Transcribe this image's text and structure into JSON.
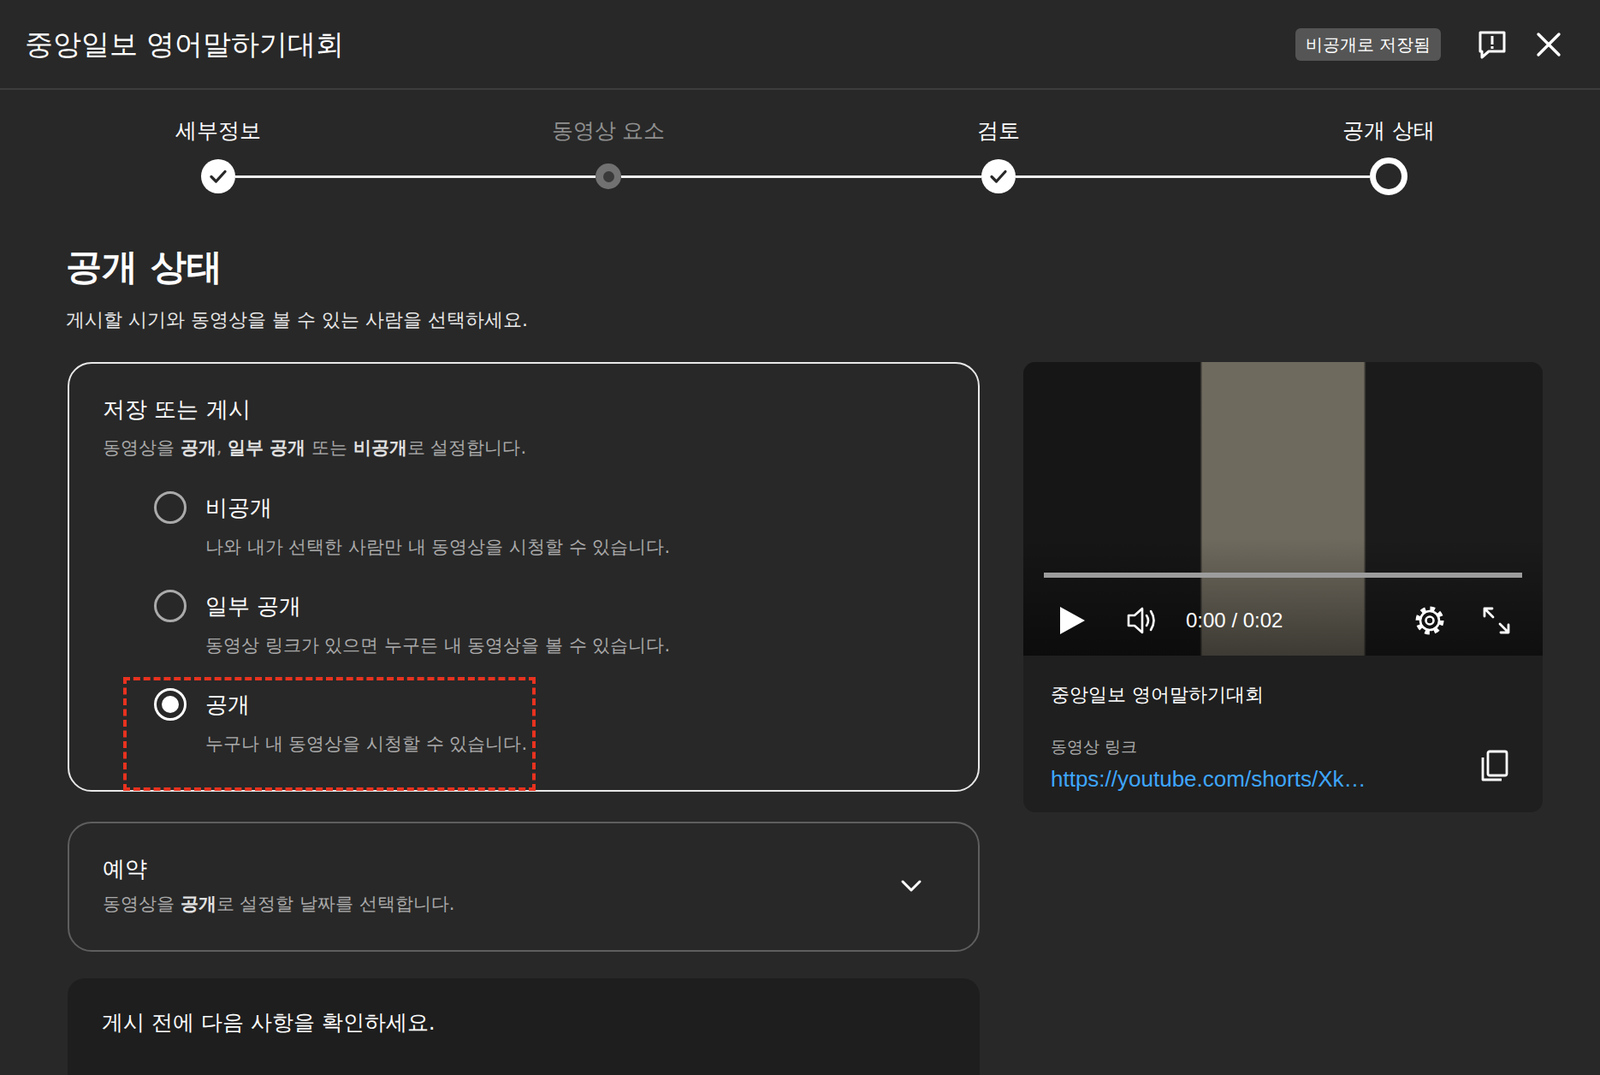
{
  "header": {
    "title": "중앙일보 영어말하기대회",
    "badge": "비공개로 저장됨"
  },
  "steps": [
    {
      "label": "세부정보",
      "state": "done"
    },
    {
      "label": "동영상 요소",
      "state": "pending"
    },
    {
      "label": "검토",
      "state": "done"
    },
    {
      "label": "공개 상태",
      "state": "current"
    }
  ],
  "page": {
    "heading": "공개 상태",
    "subtitle": "게시할 시기와 동영상을 볼 수 있는 사람을 선택하세요."
  },
  "visibility": {
    "title": "저장 또는 게시",
    "description": [
      {
        "text": "동영상을 ",
        "bold": false
      },
      {
        "text": "공개",
        "bold": true
      },
      {
        "text": ", ",
        "bold": false
      },
      {
        "text": "일부 공개",
        "bold": true
      },
      {
        "text": " 또는 ",
        "bold": false
      },
      {
        "text": "비공개",
        "bold": true
      },
      {
        "text": "로 설정합니다.",
        "bold": false
      }
    ],
    "options": [
      {
        "label": "비공개",
        "description": "나와 내가 선택한 사람만 내 동영상을 시청할 수 있습니다.",
        "selected": false,
        "highlighted": false
      },
      {
        "label": "일부 공개",
        "description": "동영상 링크가 있으면 누구든 내 동영상을 볼 수 있습니다.",
        "selected": false,
        "highlighted": false
      },
      {
        "label": "공개",
        "description": "누구나 내 동영상을 시청할 수 있습니다.",
        "selected": true,
        "highlighted": true
      }
    ]
  },
  "schedule": {
    "title": "예약",
    "description": [
      {
        "text": "동영상을 ",
        "bold": false
      },
      {
        "text": "공개",
        "bold": true
      },
      {
        "text": "로 설정할 날짜를 선택합니다.",
        "bold": false
      }
    ],
    "expanded": false
  },
  "checklist": {
    "title": "게시 전에 다음 사항을 확인하세요."
  },
  "preview": {
    "time": "0:00 / 0:02",
    "level": 0,
    "title": "중앙일보 영어말하기대회",
    "link_label": "동영상 링크",
    "link": "https://youtube.com/shorts/Xk…"
  }
}
